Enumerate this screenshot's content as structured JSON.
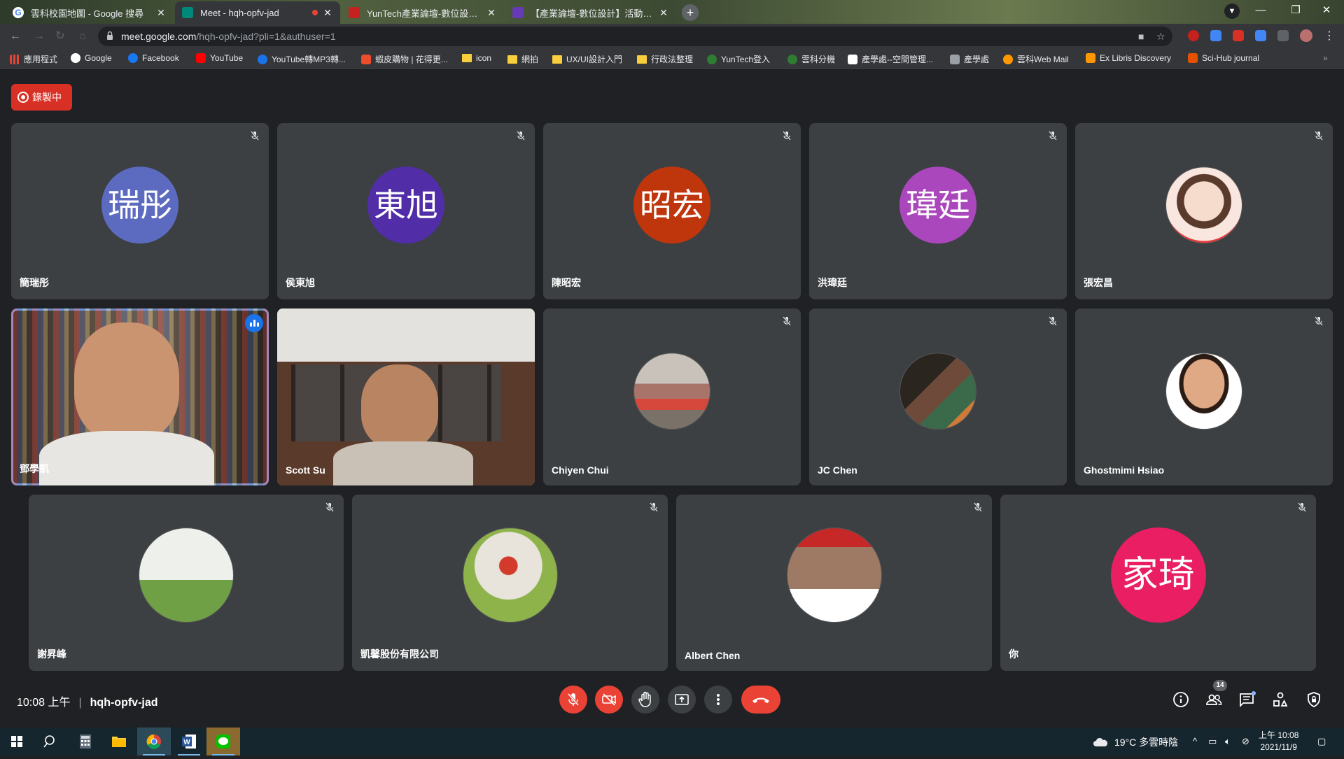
{
  "browser": {
    "tabs": [
      {
        "label": "雲科校園地圖 - Google 搜尋",
        "favicon_color": "#4285f4",
        "active": false
      },
      {
        "label": "Meet - hqh-opfv-jad",
        "favicon_color": "#00897b",
        "active": true,
        "recording": true
      },
      {
        "label": "YunTech產業論壇-數位設計產學",
        "favicon_color": "#c5221f",
        "active": false
      },
      {
        "label": "【產業論壇-數位設計】活動濱年",
        "favicon_color": "#673ab7",
        "active": false
      }
    ],
    "url_host": "meet.google.com",
    "url_path": "/hqh-opfv-jad?pli=1&authuser=1",
    "bookmarks": [
      {
        "label": "應用程式",
        "icon": "apps-grid-icon",
        "color": "#ea4335"
      },
      {
        "label": "Google",
        "icon": "google-icon",
        "color": "#4285f4"
      },
      {
        "label": "Facebook",
        "icon": "facebook-icon",
        "color": "#1877f2"
      },
      {
        "label": "YouTube",
        "icon": "youtube-icon",
        "color": "#ff0000"
      },
      {
        "label": "YouTube轉MP3轉...",
        "icon": "mp3-icon",
        "color": "#1a73e8"
      },
      {
        "label": "蝦皮購物 | 花得更...",
        "icon": "shopee-icon",
        "color": "#ee4d2d"
      },
      {
        "label": "icon",
        "icon": "folder-icon",
        "color": "#f9ce3c"
      },
      {
        "label": "網拍",
        "icon": "folder-icon",
        "color": "#f9ce3c"
      },
      {
        "label": "UX/UI設計入門",
        "icon": "folder-icon",
        "color": "#f9ce3c"
      },
      {
        "label": "行政法整理",
        "icon": "folder-icon",
        "color": "#f9ce3c"
      },
      {
        "label": "YunTech登入",
        "icon": "yuntech-icon",
        "color": "#2e7d32"
      },
      {
        "label": "雲科分機",
        "icon": "yuntech-icon",
        "color": "#2e7d32"
      },
      {
        "label": "產學處--空間管理...",
        "icon": "table-icon",
        "color": "#ffffff"
      },
      {
        "label": "產學處",
        "icon": "pen-icon",
        "color": "#9aa0a6"
      },
      {
        "label": "雲科Web Mail",
        "icon": "mail-icon",
        "color": "#ff9800"
      },
      {
        "label": "Ex Libris Discovery",
        "icon": "exlibris-icon",
        "color": "#ff9800"
      },
      {
        "label": "Sci-Hub journal",
        "icon": "scihub-icon",
        "color": "#e65100"
      }
    ]
  },
  "meet": {
    "recording_label": "錄製中",
    "participants_row1": [
      {
        "name": "簡瑞彤",
        "avatar_text": "瑞彤",
        "avatar_color": "#5c6bc0",
        "muted": true
      },
      {
        "name": "侯東旭",
        "avatar_text": "東旭",
        "avatar_color": "#512da8",
        "muted": true
      },
      {
        "name": "陳昭宏",
        "avatar_text": "昭宏",
        "avatar_color": "#bf360c",
        "muted": true
      },
      {
        "name": "洪瑋廷",
        "avatar_text": "瑋廷",
        "avatar_color": "#ab47bc",
        "muted": true
      },
      {
        "name": "張宏昌",
        "avatar_text": "",
        "avatar_color": "#f4d7c8",
        "muted": true,
        "photo": "child-photo"
      }
    ],
    "participants_row2": [
      {
        "name": "鄧學凱",
        "video": "bookshelf-video",
        "speaking": true
      },
      {
        "name": "Scott Su",
        "video": "office-video",
        "speaking": false
      },
      {
        "name": "Chiyen Chui",
        "avatar_text": "",
        "avatar_color": "#8d6e63",
        "muted": true,
        "photo": "street-photo"
      },
      {
        "name": "JC Chen",
        "avatar_text": "",
        "avatar_color": "#4e342e",
        "muted": true,
        "photo": "people-photo"
      },
      {
        "name": "Ghostmimi Hsiao",
        "avatar_text": "",
        "avatar_color": "#f1e0d6",
        "muted": true,
        "photo": "portrait-photo"
      }
    ],
    "participants_row3": [
      {
        "name": "謝昇峰",
        "avatar_text": "",
        "avatar_color": "#6a9f3a",
        "muted": true,
        "photo": "field-photo"
      },
      {
        "name": "凱馨股份有限公司",
        "avatar_text": "",
        "avatar_color": "#7cb342",
        "muted": true,
        "photo": "rooster-photo"
      },
      {
        "name": "Albert Chen",
        "avatar_text": "",
        "avatar_color": "#455a64",
        "muted": true,
        "photo": "cyclist-photo"
      },
      {
        "name": "你",
        "avatar_text": "家琦",
        "avatar_color": "#e91e63",
        "muted": true
      }
    ],
    "time": "10:08 上午",
    "meeting_code": "hqh-opfv-jad",
    "people_count": "14"
  },
  "taskbar": {
    "weather": "19°C 多雲時陰",
    "time": "上午 10:08",
    "date": "2021/11/9"
  }
}
